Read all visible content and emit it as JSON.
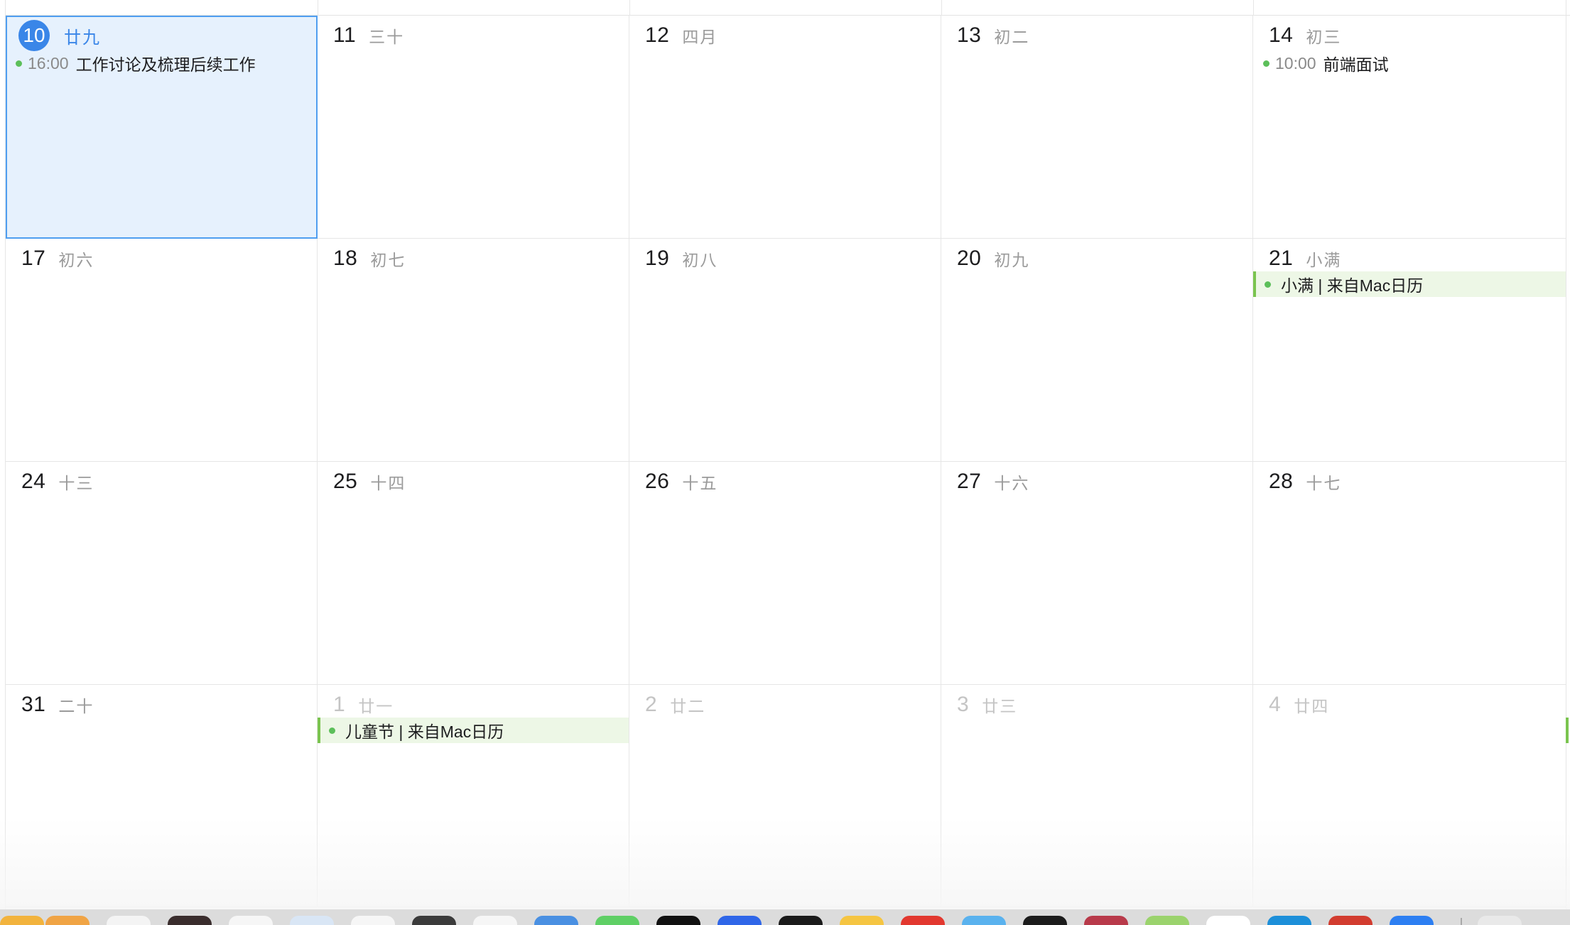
{
  "colors": {
    "today_bg": "#e6f1fd",
    "today_border": "#4f9ef0",
    "today_badge": "#3a86e8",
    "event_dot": "#5cbf5a",
    "allday_bg": "#edf7e6",
    "allday_bar": "#7ac44f"
  },
  "weeks": [
    [
      {
        "num": "10",
        "lunar": "廿九",
        "today": true,
        "events": [
          {
            "time": "16:00",
            "title": "工作讨论及梳理后续工作"
          }
        ]
      },
      {
        "num": "11",
        "lunar": "三十"
      },
      {
        "num": "12",
        "lunar": "四月"
      },
      {
        "num": "13",
        "lunar": "初二"
      },
      {
        "num": "14",
        "lunar": "初三",
        "events": [
          {
            "time": "10:00",
            "title": "前端面试"
          }
        ]
      }
    ],
    [
      {
        "num": "17",
        "lunar": "初六"
      },
      {
        "num": "18",
        "lunar": "初七"
      },
      {
        "num": "19",
        "lunar": "初八"
      },
      {
        "num": "20",
        "lunar": "初九"
      },
      {
        "num": "21",
        "lunar": "小满",
        "allday": "小满 | 来自Mac日历"
      }
    ],
    [
      {
        "num": "24",
        "lunar": "十三"
      },
      {
        "num": "25",
        "lunar": "十四"
      },
      {
        "num": "26",
        "lunar": "十五"
      },
      {
        "num": "27",
        "lunar": "十六"
      },
      {
        "num": "28",
        "lunar": "十七"
      }
    ],
    [
      {
        "num": "31",
        "lunar": "二十"
      },
      {
        "num": "1",
        "lunar": "廿一",
        "faded": true,
        "allday": "儿童节 | 来自Mac日历"
      },
      {
        "num": "2",
        "lunar": "廿二",
        "faded": true
      },
      {
        "num": "3",
        "lunar": "廿三",
        "faded": true
      },
      {
        "num": "4",
        "lunar": "廿四",
        "faded": true
      }
    ]
  ],
  "dock": {
    "icons": [
      "finder-icon",
      "pages-icon",
      "notes-icon",
      "terminal-icon",
      "calendar-icon",
      "safari-icon",
      "mail-icon",
      "editor-icon",
      "reminders-icon",
      "browser-icon",
      "messages-icon",
      "tiktok-icon",
      "baidu-icon",
      "screen-icon",
      "qq-icon",
      "app-red-icon",
      "feishu-icon",
      "cmd-icon",
      "music-icon",
      "wechat-icon",
      "preview-icon",
      "vscode-icon",
      "chrome-icon",
      "appstore-icon",
      "trash-icon"
    ]
  }
}
